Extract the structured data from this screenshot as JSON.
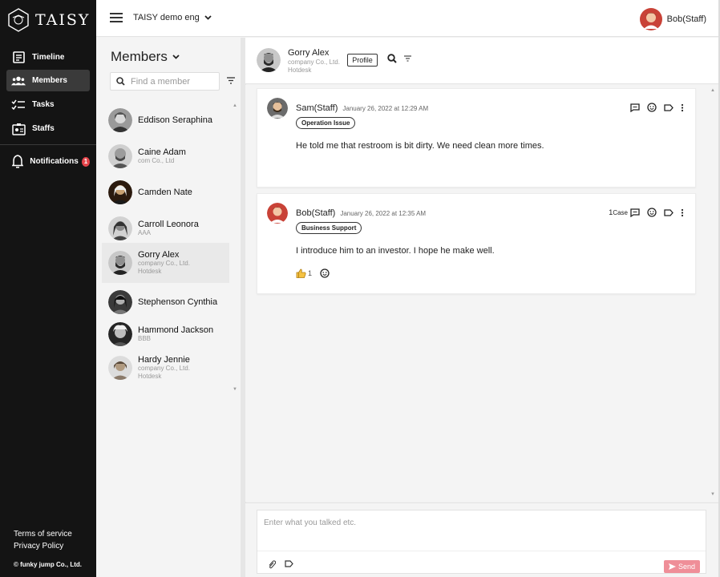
{
  "app": {
    "brand": "TAISY"
  },
  "sidebar": {
    "items": [
      {
        "label": "Timeline",
        "icon": "timeline-icon"
      },
      {
        "label": "Members",
        "icon": "members-icon"
      },
      {
        "label": "Tasks",
        "icon": "tasks-icon"
      },
      {
        "label": "Staffs",
        "icon": "staffs-icon"
      }
    ],
    "notifications": {
      "label": "Notifications",
      "count": "1"
    },
    "footer": {
      "terms": "Terms of service",
      "privacy": "Privacy Policy",
      "copyright": "© funky jump Co., Ltd."
    }
  },
  "topbar": {
    "workspace": "TAISY demo eng",
    "user": "Bob(Staff)"
  },
  "members": {
    "title": "Members",
    "search_placeholder": "Find a member",
    "list": [
      {
        "name": "Eddison Seraphina",
        "sub1": "",
        "sub2": ""
      },
      {
        "name": "Caine Adam",
        "sub1": "com Co., Ltd",
        "sub2": ""
      },
      {
        "name": "Camden Nate",
        "sub1": "",
        "sub2": ""
      },
      {
        "name": "Carroll Leonora",
        "sub1": "AAA",
        "sub2": ""
      },
      {
        "name": "Gorry Alex",
        "sub1": "company Co., Ltd.",
        "sub2": "Hotdesk"
      },
      {
        "name": "Stephenson Cynthia",
        "sub1": "",
        "sub2": ""
      },
      {
        "name": "Hammond Jackson",
        "sub1": "BBB",
        "sub2": ""
      },
      {
        "name": "Hardy Jennie",
        "sub1": "company Co., Ltd.",
        "sub2": "Hotdesk"
      }
    ]
  },
  "thread": {
    "member_name": "Gorry Alex",
    "member_company": "company Co., Ltd.",
    "member_plan": "Hotdesk",
    "profile_label": "Profile",
    "posts": [
      {
        "author": "Sam(Staff)",
        "time": "January 26, 2022 at 12:29 AM",
        "tag": "Operation Issue",
        "body": "He told me that restroom is bit dirty. We need clean more times.",
        "case": ""
      },
      {
        "author": "Bob(Staff)",
        "time": "January 26, 2022 at 12:35 AM",
        "tag": "Business Support",
        "body": "I introduce him to an investor. I hope he make well.",
        "case": "1",
        "case_label": "Case",
        "reaction_count": "1"
      }
    ]
  },
  "composer": {
    "placeholder": "Enter what you talked etc.",
    "send_label": "Send"
  },
  "colors": {
    "sidebar_bg": "#141414",
    "accent": "#ef8e98",
    "badge": "#e4444a"
  }
}
